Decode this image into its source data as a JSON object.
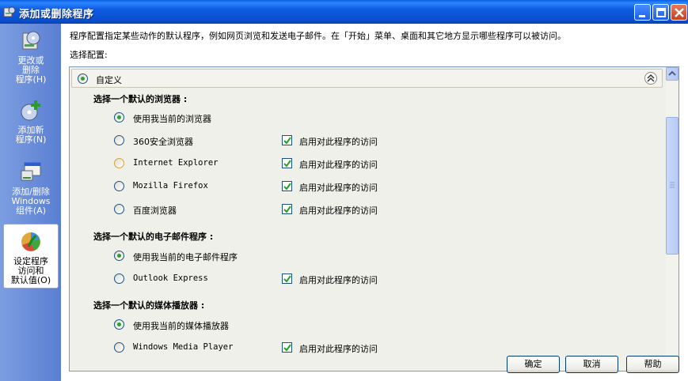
{
  "window": {
    "title": "添加或删除程序"
  },
  "sidebar": {
    "items": [
      {
        "label": "更改或\n删除\n程序(H)",
        "icon": "change-remove-programs-icon"
      },
      {
        "label": "添加新\n程序(N)",
        "icon": "add-new-programs-icon"
      },
      {
        "label": "添加/删除\nWindows\n组件(A)",
        "icon": "windows-components-icon"
      },
      {
        "label": "设定程序\n访问和\n默认值(O)",
        "icon": "program-access-defaults-icon"
      }
    ]
  },
  "content": {
    "description": "程序配置指定某些动作的默认程序，例如网页浏览和发送电子邮件。在「开始」菜单、桌面和其它地方显示哪些程序可以被访问。",
    "config_label": "选择配置:",
    "config_name": "自定义",
    "enable_text": "启用对此程序的访问",
    "sections": [
      {
        "title": "选择一个默认的浏览器 :",
        "options": [
          {
            "label": "使用我当前的浏览器",
            "checked": true,
            "has_enable": false
          },
          {
            "label": "360安全浏览器",
            "checked": false,
            "has_enable": true
          },
          {
            "label": "Internet Explorer",
            "checked": false,
            "has_enable": true
          },
          {
            "label": "Mozilla Firefox",
            "checked": false,
            "has_enable": true
          },
          {
            "label": "百度浏览器",
            "checked": false,
            "has_enable": true
          }
        ]
      },
      {
        "title": "选择一个默认的电子邮件程序 :",
        "options": [
          {
            "label": "使用我当前的电子邮件程序",
            "checked": true,
            "has_enable": false
          },
          {
            "label": "Outlook Express",
            "checked": false,
            "has_enable": true
          }
        ]
      },
      {
        "title": "选择一个默认的媒体播放器 :",
        "options": [
          {
            "label": "使用我当前的媒体播放器",
            "checked": true,
            "has_enable": false
          },
          {
            "label": "Windows Media Player",
            "checked": false,
            "has_enable": true
          }
        ]
      }
    ]
  },
  "buttons": {
    "ok": "确定",
    "cancel": "取消",
    "help": "帮助"
  }
}
